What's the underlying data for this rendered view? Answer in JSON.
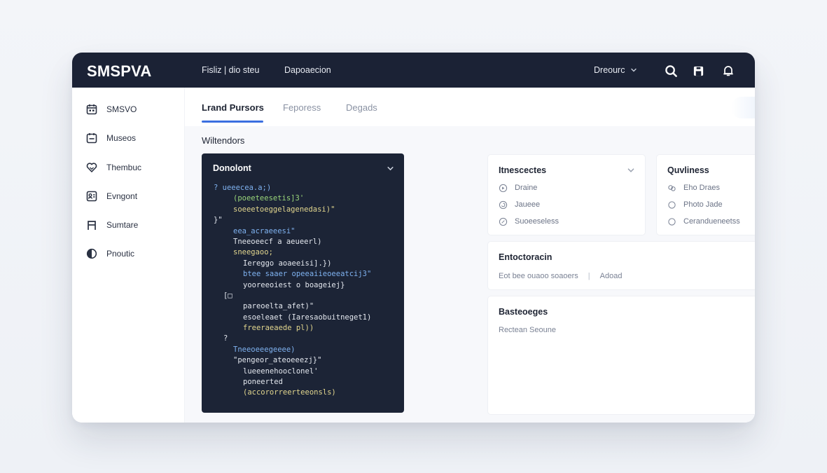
{
  "app": {
    "brand": "SMSPVA",
    "nav": [
      "Fisliz | dio steu",
      "Dapoaecion"
    ],
    "user_menu": "Dreourc"
  },
  "sidebar": {
    "items": [
      {
        "label": "SMSVO",
        "icon": "calendar-icon"
      },
      {
        "label": "Museos",
        "icon": "calendar-alt-icon"
      },
      {
        "label": "Thembuc",
        "icon": "heart-icon"
      },
      {
        "label": "Evngont",
        "icon": "contacts-icon"
      },
      {
        "label": "Sumtare",
        "icon": "text-icon"
      },
      {
        "label": "Pnoutic",
        "icon": "half-circle-icon"
      }
    ]
  },
  "tabs": [
    {
      "label": "Lrand Pursors",
      "active": true
    },
    {
      "label": "Feporess",
      "active": false
    },
    {
      "label": "Degads",
      "active": false
    }
  ],
  "section": {
    "title": "Wiltendors"
  },
  "code_panel": {
    "title": "Donolont",
    "lines": [
      {
        "indent": 0,
        "color": "b",
        "text": "? ueeecea.a;)"
      },
      {
        "indent": 2,
        "color": "g",
        "text": "(poeeteesetis]3'"
      },
      {
        "indent": 2,
        "color": "y",
        "text": "soeeetoeggelagenedasi)\""
      },
      {
        "indent": 0,
        "color": "w",
        "text": "}\""
      },
      {
        "indent": 2,
        "color": "b",
        "text": "eea_acraeeesi\""
      },
      {
        "indent": 2,
        "color": "w",
        "text": "Tneeoeecf a aeueerl)"
      },
      {
        "indent": 2,
        "color": "y",
        "text": "sneegaoo;"
      },
      {
        "indent": 3,
        "color": "w",
        "text": "Iereggo aoaeeisi].})"
      },
      {
        "indent": 3,
        "color": "b",
        "text": "btee saaer opeeaiieoeeatcij3\""
      },
      {
        "indent": 3,
        "color": "w",
        "text": "yooreeoiest o boageiej}"
      },
      {
        "indent": 1,
        "color": "w",
        "text": "[□"
      },
      {
        "indent": 3,
        "color": "w",
        "text": "pareoelta_afet)\""
      },
      {
        "indent": 3,
        "color": "w",
        "text": "esoeleaet (Iaresaobuitneget1)"
      },
      {
        "indent": 3,
        "color": "y",
        "text": "freeraeaede pl))"
      },
      {
        "indent": 1,
        "color": "w",
        "text": "?"
      },
      {
        "indent": 2,
        "color": "b",
        "text": "Tneeoeeegeeee)"
      },
      {
        "indent": 2,
        "color": "w",
        "text": "\"pengeor_ateoeeezj}\""
      },
      {
        "indent": 3,
        "color": "w",
        "text": "lueeenehooclonel'"
      },
      {
        "indent": 3,
        "color": "w",
        "text": "poneerted"
      },
      {
        "indent": 3,
        "color": "y",
        "text": "(accororreerteeonsls)"
      }
    ]
  },
  "cards": {
    "integrations": {
      "title": "Itnescectes",
      "options": [
        {
          "label": "Draine",
          "icon": "play-circle-icon"
        },
        {
          "label": "Jaueee",
          "icon": "spiral-icon"
        },
        {
          "label": "Suoeeseless",
          "icon": "compass-icon"
        }
      ]
    },
    "qualities": {
      "title": "Quvliness",
      "options": [
        {
          "label": "Eho Draes",
          "icon": "link-icon"
        },
        {
          "label": "Photo Jade",
          "icon": "circle-icon"
        },
        {
          "label": "Cerandueneetss",
          "icon": "circle-outline-icon"
        }
      ]
    },
    "entertainment": {
      "title": "Entoctoracin",
      "text": "Eot bee ouaoo soaoers",
      "separator": "|",
      "action": "Adoad"
    },
    "bases": {
      "title": "Basteoeges",
      "text": "Rectean Seoune"
    }
  },
  "colors": {
    "topbar": "#1b2235",
    "accent": "#3b6fe0",
    "code_bg": "#1c2436"
  }
}
